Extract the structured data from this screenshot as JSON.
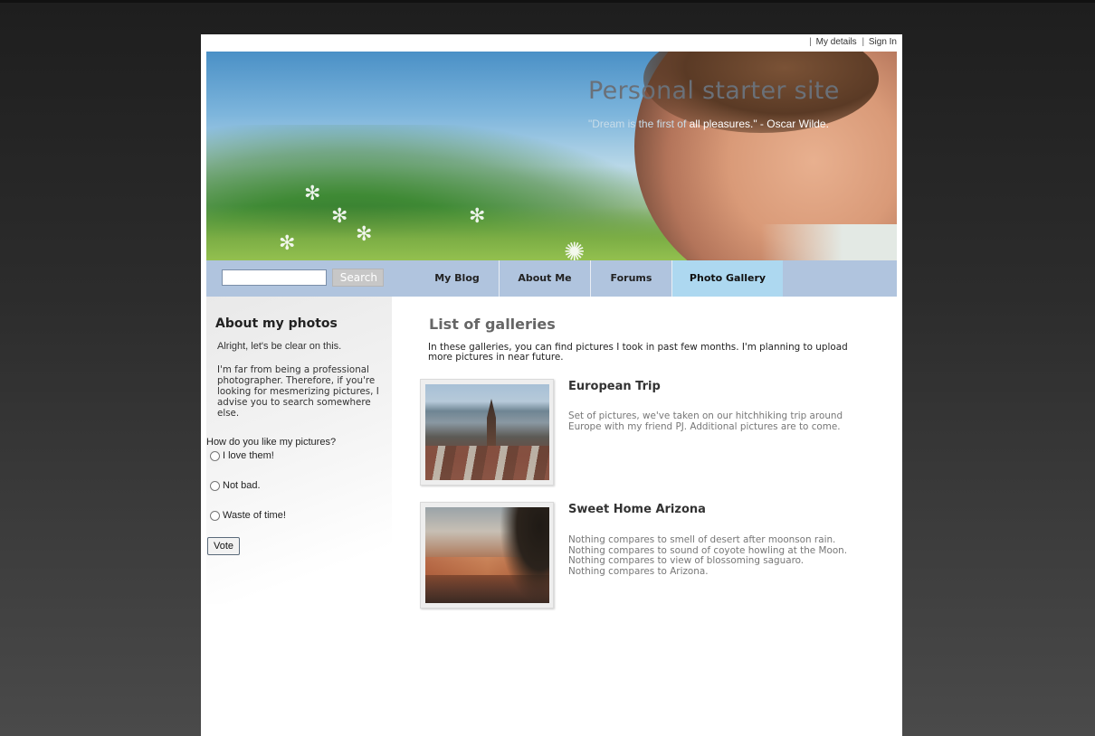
{
  "toplinks": {
    "my_details": "My details",
    "sign_in": "Sign In",
    "separator": "|"
  },
  "header": {
    "title": "Personal starter site",
    "quote_faded": "\"Dream is the first of",
    "quote_main": " all pleasures.\" - Oscar Wilde."
  },
  "search": {
    "value": "",
    "button_label": "Search"
  },
  "nav": {
    "items": [
      {
        "label": "My Blog",
        "active": false
      },
      {
        "label": "About Me",
        "active": false
      },
      {
        "label": "Forums",
        "active": false
      },
      {
        "label": "Photo Gallery",
        "active": true
      }
    ]
  },
  "sidebar": {
    "title": "About my photos",
    "p1": "Alright, let's be clear on this.",
    "p2": "I'm far from being a professional photographer. Therefore, if you're looking for mesmerizing pictures, I advise you to search somewhere else.",
    "poll_question": "How do you like my pictures?",
    "poll_options": [
      "I love them!",
      "Not bad.",
      "Waste of time!"
    ],
    "vote_label": "Vote"
  },
  "main": {
    "title": "List of galleries",
    "intro": "In these galleries, you can find pictures I took in past few months. I'm planning to upload more pictures in near future.",
    "galleries": [
      {
        "title": "European Trip",
        "description": "Set of pictures, we've taken on our hitchhiking trip around Europe with my friend PJ. Additional pictures are to come."
      },
      {
        "title": "Sweet Home Arizona",
        "lines": [
          "Nothing compares to smell of desert after moonson rain.",
          "Nothing compares to sound of coyote howling at the Moon.",
          "Nothing compares to view of blossoming saguaro.",
          "Nothing compares to Arizona."
        ]
      }
    ]
  },
  "colors": {
    "nav_bg": "#b0c4de",
    "nav_active": "#add8f0",
    "page_bg": "#ffffff",
    "outer_bg": "#2c2c2c"
  }
}
